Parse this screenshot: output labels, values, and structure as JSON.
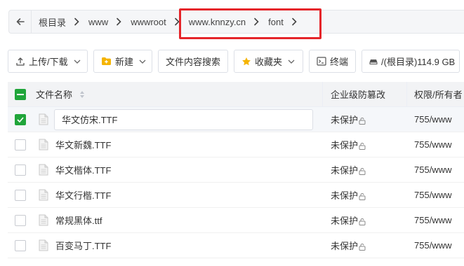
{
  "breadcrumb": {
    "segments": [
      "根目录",
      "www",
      "wwwroot",
      "www.knnzy.cn",
      "font"
    ]
  },
  "toolbar": {
    "upload_label": "上传/下载",
    "new_label": "新建",
    "search_content_label": "文件内容搜索",
    "favorites_label": "收藏夹",
    "terminal_label": "终端",
    "disk_label": "/(根目录)114.9 GB"
  },
  "table": {
    "headers": {
      "name": "文件名称",
      "protection": "企业级防篡改",
      "perm": "权限/所有者"
    },
    "rows": [
      {
        "name": "华文仿宋.TTF",
        "protection": "未保护",
        "perm": "755/www",
        "selected": true,
        "editing": true
      },
      {
        "name": "华文新魏.TTF",
        "protection": "未保护",
        "perm": "755/www"
      },
      {
        "name": "华文楷体.TTF",
        "protection": "未保护",
        "perm": "755/www"
      },
      {
        "name": "华文行楷.TTF",
        "protection": "未保护",
        "perm": "755/www"
      },
      {
        "name": "常规黑体.ttf",
        "protection": "未保护",
        "perm": "755/www"
      },
      {
        "name": "百变马丁.TTF",
        "protection": "未保护",
        "perm": "755/www"
      }
    ]
  },
  "colors": {
    "accent": "#20a53a",
    "highlight": "#e5252a",
    "folder": "#f5b400"
  }
}
